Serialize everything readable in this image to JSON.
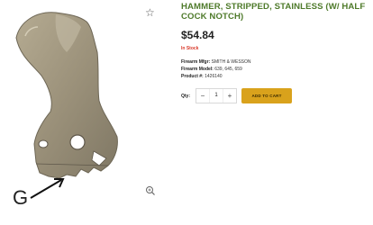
{
  "product": {
    "title": "HAMMER, STRIPPED, STAINLESS (W/ HALF COCK NOTCH)",
    "price": "$54.84",
    "stock_status": "In Stock",
    "specs": [
      {
        "label": "Firearm Mfgr:",
        "value": "SMITH & WESSON"
      },
      {
        "label": "Firearm Model:",
        "value": "639, 645, 659"
      },
      {
        "label": "Product #:",
        "value": "1426140"
      }
    ]
  },
  "purchase": {
    "qty_label": "Qty:",
    "qty_value": "1",
    "minus": "−",
    "plus": "+",
    "add_to_cart": "ADD TO CART"
  },
  "gallery": {
    "annotation_letter": "G",
    "favorite_icon": "star-outline-icon",
    "zoom_icon": "magnifier-icon"
  },
  "colors": {
    "title": "#4e7a2a",
    "stock": "#d93a2b",
    "cart_button": "#d9a21c"
  }
}
